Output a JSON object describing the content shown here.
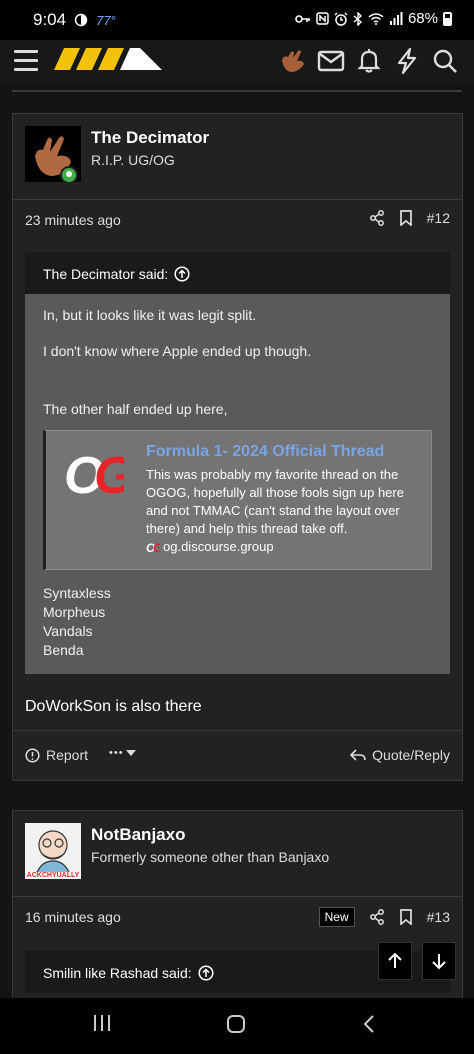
{
  "status": {
    "time": "9:04",
    "temp": "77°",
    "battery": "68%"
  },
  "header": {
    "icons": [
      "hamburger-menu-icon",
      "site-logo",
      "user-avatar-icon",
      "mail-icon",
      "bell-icon",
      "lightning-icon",
      "search-icon"
    ],
    "logo_colors": [
      "#f3c20c",
      "#f3c20c",
      "#f3c20c",
      "#ffffff"
    ]
  },
  "posts": [
    {
      "author": "The Decimator",
      "user_title": "R.I.P. UG/OG",
      "time": "23 minutes ago",
      "number": "#12",
      "quote": {
        "author_label": "The Decimator said:",
        "paragraphs": [
          "In, but it looks like it was legit split.",
          "I don't know where Apple ended up though.",
          "The other half ended up here,"
        ],
        "onebox": {
          "logo_text": "OG",
          "title": "Formula 1- 2024 Official Thread",
          "excerpt": "This was probably my favorite thread on the OGOG, hopefully all those fools sign up here and not TMMAC (can't stand the layout over there) and help this thread take off.",
          "source": "og.discourse.group"
        },
        "names": [
          "Syntaxless",
          "Morpheus",
          "Vandals",
          "Benda"
        ]
      },
      "body": "DoWorkSon is also there",
      "actions": {
        "report": "Report",
        "more": "•••",
        "quote_reply": "Quote/Reply"
      }
    },
    {
      "author": "NotBanjaxo",
      "user_title": "Formerly someone other than Banjaxo",
      "avatar_caption": "ACKCHYUALLY",
      "time": "16 minutes ago",
      "badge": "New",
      "number": "#13",
      "quote": {
        "author_label": "Smilin like Rashad said:"
      }
    }
  ],
  "colors": {
    "link": "#78a6e8",
    "online": "#3fae49",
    "og_red": "#e8242b"
  }
}
